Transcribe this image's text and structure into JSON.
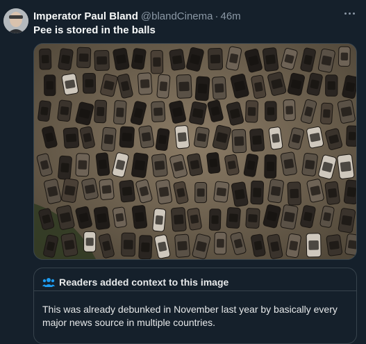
{
  "tweet": {
    "author_name": "Imperator Paul Bland",
    "author_handle": "@blandCinema",
    "separator": "·",
    "time": "46m",
    "text": "Pee is stored in the balls"
  },
  "icons": {
    "more": "more-options-icon",
    "readers": "people-icon"
  },
  "media": {
    "subject": "aerial view of rows of burnt-out cars"
  },
  "community_note": {
    "title": "Readers added context to this image",
    "body": "This was already debunked in November last year by basically every major news source in multiple countries."
  },
  "colors": {
    "background": "#15202b",
    "text_primary": "#f7f9f9",
    "text_secondary": "#8b98a5",
    "note_icon": "#1d9bf0",
    "border": "#38444d"
  }
}
